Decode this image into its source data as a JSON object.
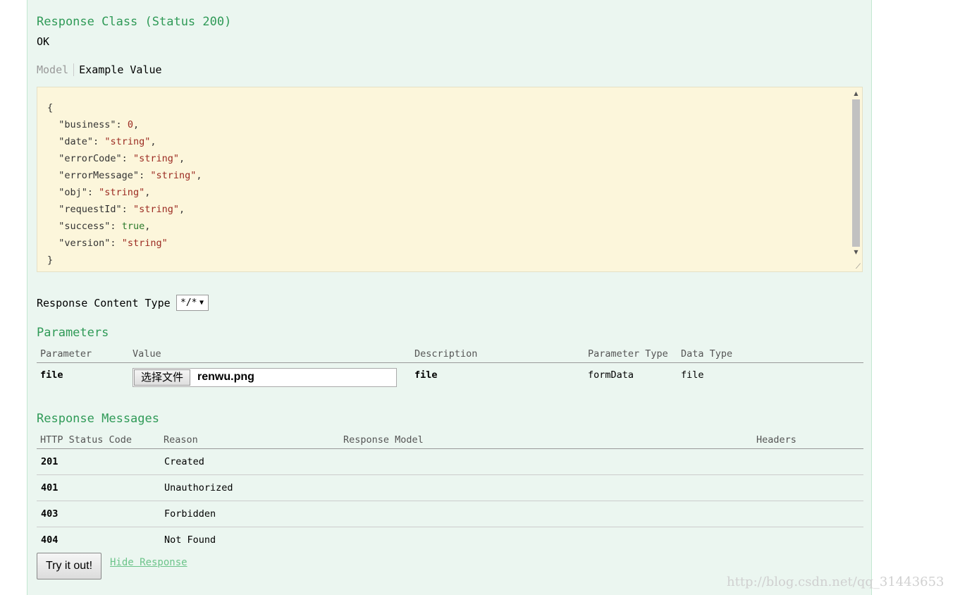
{
  "response_class": {
    "title": "Response Class (Status 200)",
    "status_text": "OK",
    "tabs": {
      "model": "Model",
      "example": "Example Value"
    },
    "example_json": {
      "open": "{",
      "close": "}",
      "fields": [
        {
          "key": "\"business\"",
          "value": "0",
          "type": "number",
          "trail": ","
        },
        {
          "key": "\"date\"",
          "value": "\"string\"",
          "type": "string",
          "trail": ","
        },
        {
          "key": "\"errorCode\"",
          "value": "\"string\"",
          "type": "string",
          "trail": ","
        },
        {
          "key": "\"errorMessage\"",
          "value": "\"string\"",
          "type": "string",
          "trail": ","
        },
        {
          "key": "\"obj\"",
          "value": "\"string\"",
          "type": "string",
          "trail": ","
        },
        {
          "key": "\"requestId\"",
          "value": "\"string\"",
          "type": "string",
          "trail": ","
        },
        {
          "key": "\"success\"",
          "value": "true",
          "type": "bool",
          "trail": ","
        },
        {
          "key": "\"version\"",
          "value": "\"string\"",
          "type": "string",
          "trail": ""
        }
      ]
    }
  },
  "content_type": {
    "label": "Response Content Type",
    "selected": "*/*"
  },
  "parameters": {
    "title": "Parameters",
    "headers": [
      "Parameter",
      "Value",
      "Description",
      "Parameter Type",
      "Data Type"
    ],
    "rows": [
      {
        "name": "file",
        "button_label": "选择文件",
        "file_name": "renwu.png",
        "description": "file",
        "param_type": "formData",
        "data_type": "file"
      }
    ]
  },
  "response_messages": {
    "title": "Response Messages",
    "headers": [
      "HTTP Status Code",
      "Reason",
      "Response Model",
      "Headers"
    ],
    "rows": [
      {
        "code": "201",
        "reason": "Created"
      },
      {
        "code": "401",
        "reason": "Unauthorized"
      },
      {
        "code": "403",
        "reason": "Forbidden"
      },
      {
        "code": "404",
        "reason": "Not Found"
      }
    ]
  },
  "actions": {
    "try_label": "Try it out!",
    "hide_label": "Hide Response"
  },
  "watermark": "http://blog.csdn.net/qq_31443653",
  "colors": {
    "panel_bg": "#ebf6f0",
    "heading_green": "#2f9a57",
    "code_bg": "#fcf6db",
    "string_red": "#9b2a21",
    "bool_green": "#2a7a2a"
  }
}
